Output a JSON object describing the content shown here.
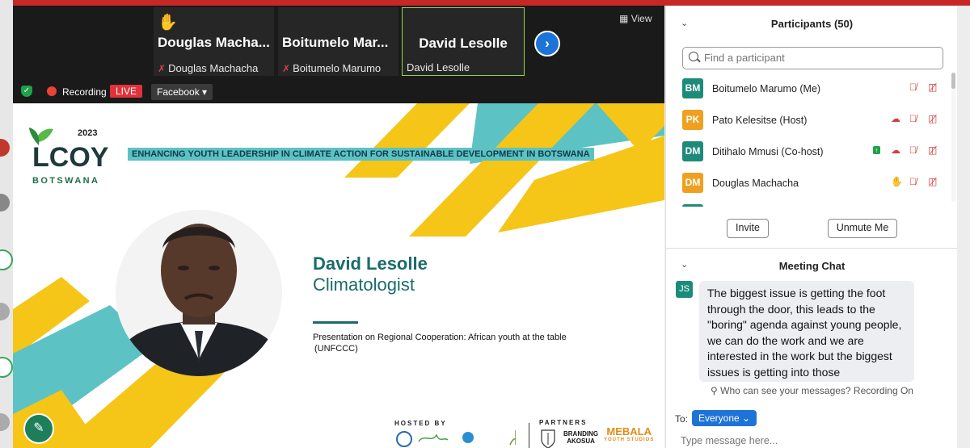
{
  "meeting": {
    "thumbnails": [
      {
        "display_name": "Douglas Macha...",
        "label": "Douglas Machacha",
        "raised_hand": true
      },
      {
        "display_name": "Boitumelo Mar...",
        "label": "Boitumelo Marumo"
      },
      {
        "display_name": "David Lesolle",
        "label": "David Lesolle",
        "active": true
      }
    ],
    "view_label": "View",
    "recording_label": "Recording",
    "live_label": "LIVE",
    "stream_target": "Facebook"
  },
  "slide": {
    "logo_year": "2023",
    "logo_name": "LCOY",
    "logo_country": "BOTSWANA",
    "headline": "ENHANCING YOUTH LEADERSHIP IN CLIMATE ACTION FOR SUSTAINABLE DEVELOPMENT IN BOTSWANA",
    "presenter_name": "David Lesolle",
    "presenter_role": "Climatologist",
    "topic_line1": "Presentation on Regional Cooperation: African youth at the table",
    "topic_line2": "(UNFCCC)",
    "hosted_by": "HOSTED BY",
    "partners": "PARTNERS",
    "partner_branding": "BRANDING",
    "partner_akosua": "AKOSUA",
    "partner_mebala": "MEBALA",
    "partner_mebala_sub": "YOUTH STUDIOS"
  },
  "participants": {
    "title": "Participants (50)",
    "search_placeholder": "Find a participant",
    "list": [
      {
        "initials": "BM",
        "name": "Boitumelo Marumo (Me)",
        "color": "#1d8b7a"
      },
      {
        "initials": "PK",
        "name": "Pato Kelesitse (Host)",
        "color": "#f0a020"
      },
      {
        "initials": "DM",
        "name": "Ditihalo Mmusi (Co-host)",
        "color": "#1d8b7a"
      },
      {
        "initials": "DM",
        "name": "Douglas Machacha",
        "color": "#f0a020"
      }
    ],
    "invite_label": "Invite",
    "unmute_label": "Unmute Me"
  },
  "chat": {
    "title": "Meeting Chat",
    "sender_initials": "JS",
    "message": "The biggest issue is getting the foot through the door, this leads to the \"boring\" agenda against young people, we can do the work and we are interested in the work but the biggest issues is getting into those",
    "visibility_note": "Who can see your messages? Recording On",
    "to_label": "To:",
    "recipient": "Everyone",
    "input_placeholder": "Type message here..."
  }
}
